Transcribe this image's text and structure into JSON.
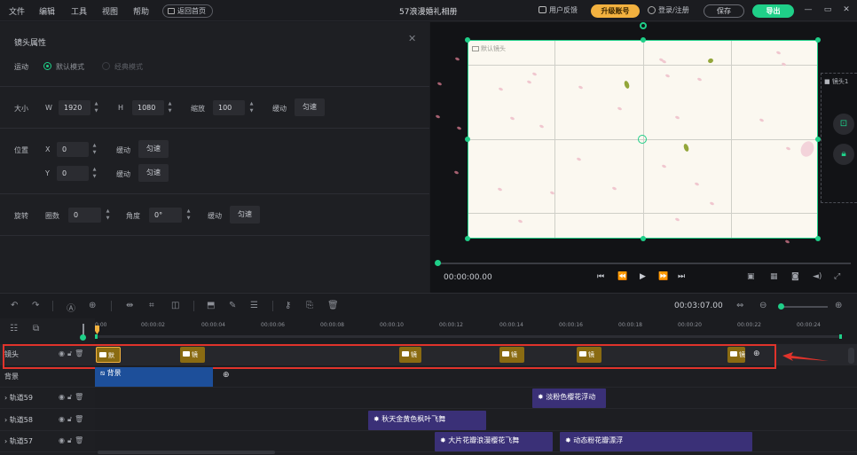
{
  "menu": {
    "file": "文件",
    "edit": "编辑",
    "tools": "工具",
    "view": "视图",
    "help": "帮助",
    "back_home": "返回首页"
  },
  "app_title": "57浪漫婚礼相册",
  "topbar": {
    "feedback": "用户反馈",
    "upgrade": "升级账号",
    "login": "登录/注册",
    "save": "保存",
    "export": "导出"
  },
  "props": {
    "title": "镜头属性",
    "motion_label": "运动",
    "mode_default": "默认模式",
    "mode_classic": "经典模式",
    "size_label": "大小",
    "w_label": "W",
    "w_value": "1920",
    "h_label": "H",
    "h_value": "1080",
    "scale_label": "缩放",
    "scale_value": "100",
    "ease_label": "缓动",
    "ease_value": "匀速",
    "pos_label": "位置",
    "x_label": "X",
    "x_value": "0",
    "y_label": "Y",
    "y_value": "0",
    "rot_label": "旋转",
    "turns_label": "圈数",
    "turns_value": "0",
    "angle_label": "角度",
    "angle_value": "0°"
  },
  "preview": {
    "canvas_label": "默认镜头",
    "side_label": "镜头1",
    "time_current": "00:00:00.00"
  },
  "timeline": {
    "total_time": "00:03:07.00",
    "ticks": [
      "0:00",
      "00:00:02",
      "00:00:04",
      "00:00:06",
      "00:00:08",
      "00:00:10",
      "00:00:12",
      "00:00:14",
      "00:00:16",
      "00:00:18",
      "00:00:20",
      "00:00:22",
      "00:00:24"
    ],
    "rows": [
      {
        "label": "镜头"
      },
      {
        "label": "背景"
      },
      {
        "label": "轨道59"
      },
      {
        "label": "轨道58"
      },
      {
        "label": "轨道57"
      }
    ],
    "cam_clips": [
      {
        "text": "默"
      },
      {
        "text": "镜"
      },
      {
        "text": "镜"
      },
      {
        "text": "镜"
      },
      {
        "text": "镜"
      },
      {
        "text": "镜"
      }
    ],
    "bg_clip": "背景",
    "fx_clips": {
      "track59": "淡粉色樱花浮动",
      "track58": "秋天金黄色枫叶飞舞",
      "track57a": "大片花瓣浪漫樱花飞舞",
      "track57b": "动态粉花瓣漂浮"
    }
  },
  "colors": {
    "accent": "#1fcf88",
    "upgrade": "#f2b13f",
    "highlight": "#e0332b",
    "cam_clip": "#8a6b12",
    "bg_clip": "#1d4f9a",
    "fx_clip": "#3a3077"
  }
}
